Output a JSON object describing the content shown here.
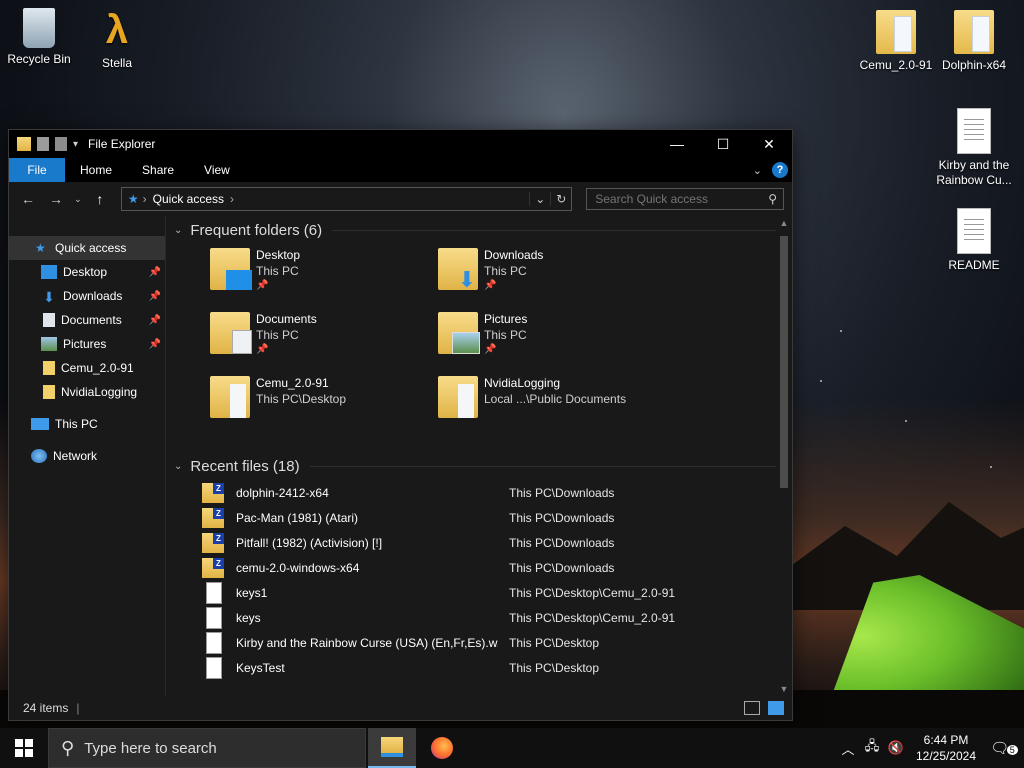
{
  "desktop": {
    "icons": [
      {
        "label": "Recycle Bin",
        "icon": "recycle-bin-icon"
      },
      {
        "label": "Stella",
        "icon": "stella-icon"
      },
      {
        "label": "Cemu_2.0-91",
        "icon": "folder-icon"
      },
      {
        "label": "Dolphin-x64",
        "icon": "folder-icon"
      },
      {
        "label": "Kirby and the Rainbow Cu...",
        "icon": "document-icon"
      },
      {
        "label": "README",
        "icon": "document-icon"
      }
    ]
  },
  "window": {
    "title": "File Explorer",
    "ribbon_tabs": [
      "File",
      "Home",
      "Share",
      "View"
    ],
    "help": "?",
    "address": {
      "location": "Quick access"
    },
    "search": {
      "placeholder": "Search Quick access"
    },
    "status": "24 items"
  },
  "navpane": {
    "quick_access": "Quick access",
    "pinned": [
      "Desktop",
      "Downloads",
      "Documents",
      "Pictures"
    ],
    "recent": [
      "Cemu_2.0-91",
      "NvidiaLogging"
    ],
    "this_pc": "This PC",
    "network": "Network"
  },
  "frequent": {
    "header": "Frequent folders (6)",
    "folders": [
      {
        "name": "Desktop",
        "path": "This PC",
        "pinned": true
      },
      {
        "name": "Downloads",
        "path": "This PC",
        "pinned": true
      },
      {
        "name": "Documents",
        "path": "This PC",
        "pinned": true
      },
      {
        "name": "Pictures",
        "path": "This PC",
        "pinned": true
      },
      {
        "name": "Cemu_2.0-91",
        "path": "This PC\\Desktop",
        "pinned": false
      },
      {
        "name": "NvidiaLogging",
        "path": "Local ...\\Public Documents",
        "pinned": false
      }
    ]
  },
  "recent_files": {
    "header": "Recent files (18)",
    "files": [
      {
        "name": "dolphin-2412-x64",
        "location": "This PC\\Downloads",
        "type": "zip"
      },
      {
        "name": "Pac-Man (1981) (Atari)",
        "location": "This PC\\Downloads",
        "type": "zip"
      },
      {
        "name": "Pitfall! (1982) (Activision) [!]",
        "location": "This PC\\Downloads",
        "type": "zip"
      },
      {
        "name": "cemu-2.0-windows-x64",
        "location": "This PC\\Downloads",
        "type": "zip"
      },
      {
        "name": "keys1",
        "location": "This PC\\Desktop\\Cemu_2.0-91",
        "type": "text"
      },
      {
        "name": "keys",
        "location": "This PC\\Desktop\\Cemu_2.0-91",
        "type": "text"
      },
      {
        "name": "Kirby and the Rainbow Curse (USA) (En,Fr,Es).w...",
        "location": "This PC\\Desktop",
        "type": "file"
      },
      {
        "name": "KeysTest",
        "location": "This PC\\Desktop",
        "type": "text"
      }
    ]
  },
  "taskbar": {
    "search_placeholder": "Type here to search",
    "time": "6:44 PM",
    "date": "12/25/2024",
    "notifications": "5"
  }
}
